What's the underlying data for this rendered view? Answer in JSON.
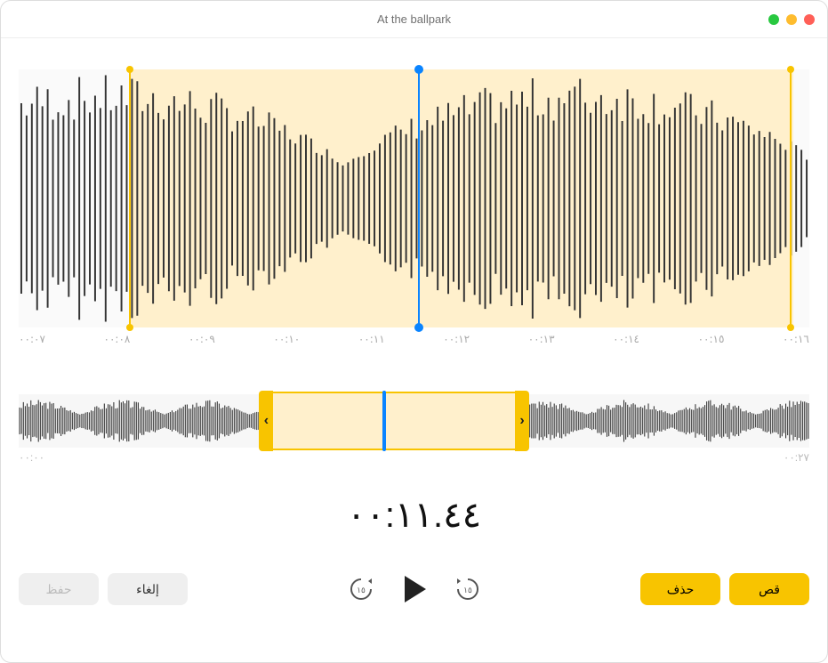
{
  "window": {
    "title": "At the ballpark"
  },
  "main_ruler": {
    "ticks": [
      "٠٠:١٦",
      "٠٠:١٥",
      "٠٠:١٤",
      "٠٠:١٣",
      "٠٠:١٢",
      "٠٠:١١",
      "٠٠:١٠",
      "٠٠:٠٩",
      "٠٠:٠٨",
      "٠٠:٠٧"
    ]
  },
  "overview_ruler": {
    "start": "٠٠:٢٧",
    "end": "٠٠:٠٠"
  },
  "time_display": "٠٠:١١.٤٤",
  "buttons": {
    "trim": "قص",
    "delete": "حذف",
    "cancel": "إلغاء",
    "save": "حفظ"
  },
  "trim": {
    "main_left_pct": 2,
    "main_right_pct": 86,
    "main_play_pct": 50.5,
    "ov_left_pct": 32,
    "ov_right_pct": 63,
    "ov_play_pct": 46
  },
  "colors": {
    "accent": "#f8c400",
    "playhead": "#0a84ff"
  }
}
